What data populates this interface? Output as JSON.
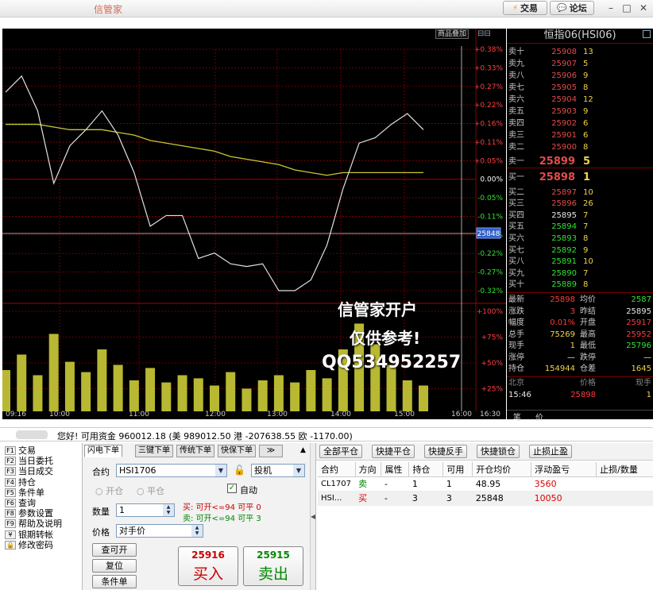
{
  "app": {
    "title": "信管家"
  },
  "titlebar": {
    "trade_label": "交易",
    "forum_label": "论坛",
    "min": "–",
    "max": "□",
    "close": "✕"
  },
  "chart": {
    "overlay_label": "商品叠加",
    "right_top_icons": "⊟⊟",
    "pct_labels": [
      "+0.38%",
      "+0.33%",
      "+0.27%",
      "+0.22%",
      "+0.16%",
      "+0.11%",
      "+0.05%",
      "0.00%",
      "-0.05%",
      "-0.11%",
      "-0.16%",
      "-0.22%",
      "-0.27%",
      "-0.32%"
    ],
    "vol_labels": [
      "+100%",
      "+75%",
      "+50%",
      "+25%"
    ],
    "time_labels": [
      "09:16",
      "10:00",
      "11:00",
      "12:00",
      "13:00",
      "14:00",
      "15:00",
      "16:00",
      "16:30"
    ],
    "cursor_value": "25848",
    "colors": {
      "price": "#e0e0e0",
      "avg": "#c8c832",
      "volume": "#b8b832",
      "grid": "#8b0000"
    }
  },
  "chart_data": {
    "type": "line",
    "x": [
      "09:16",
      "09:30",
      "09:45",
      "10:00",
      "10:15",
      "10:30",
      "10:45",
      "11:00",
      "11:15",
      "11:30",
      "11:45",
      "12:00",
      "12:15",
      "12:30",
      "12:45",
      "13:00",
      "13:15",
      "13:30",
      "13:45",
      "14:00",
      "14:15",
      "14:30",
      "14:45",
      "15:00",
      "15:15",
      "15:30",
      "15:45"
    ],
    "series": [
      {
        "values": [
          25912,
          25918,
          25905,
          25878,
          25892,
          25898,
          25905,
          25896,
          25882,
          25862,
          25866,
          25866,
          25850,
          25852,
          25848,
          25847,
          25848,
          25838,
          25838,
          25842,
          25855,
          25876,
          25893,
          25895,
          25900,
          25904,
          25898
        ]
      },
      {
        "values": [
          25900,
          25900,
          25900,
          25899,
          25898,
          25898,
          25898,
          25897,
          25896,
          25894,
          25893,
          25892,
          25891,
          25890,
          25888,
          25887,
          25886,
          25885,
          25883,
          25882,
          25881,
          25882,
          25882,
          25882,
          25882,
          25882,
          25882
        ]
      }
    ],
    "volume": [
      40,
      55,
      35,
      75,
      48,
      38,
      60,
      45,
      30,
      42,
      28,
      35,
      32,
      25,
      38,
      22,
      30,
      35,
      28,
      40,
      32,
      60,
      85,
      65,
      45,
      30,
      25
    ],
    "ylim": [
      25838,
      25928
    ],
    "vol_ylim": [
      0,
      100
    ]
  },
  "quote": {
    "title": "恒指06(HSI06)",
    "asks": [
      {
        "label": "卖十",
        "price": "25908",
        "vol": "13"
      },
      {
        "label": "卖九",
        "price": "25907",
        "vol": "5"
      },
      {
        "label": "卖八",
        "price": "25906",
        "vol": "9"
      },
      {
        "label": "卖七",
        "price": "25905",
        "vol": "8"
      },
      {
        "label": "卖六",
        "price": "25904",
        "vol": "12"
      },
      {
        "label": "卖五",
        "price": "25903",
        "vol": "9"
      },
      {
        "label": "卖四",
        "price": "25902",
        "vol": "6"
      },
      {
        "label": "卖三",
        "price": "25901",
        "vol": "6"
      },
      {
        "label": "卖二",
        "price": "25900",
        "vol": "8"
      },
      {
        "label": "卖一",
        "price": "25899",
        "vol": "5"
      }
    ],
    "bids": [
      {
        "label": "买一",
        "price": "25898",
        "vol": "1"
      },
      {
        "label": "买二",
        "price": "25897",
        "vol": "10"
      },
      {
        "label": "买三",
        "price": "25896",
        "vol": "26"
      },
      {
        "label": "买四",
        "price": "25895",
        "vol": "7"
      },
      {
        "label": "买五",
        "price": "25894",
        "vol": "7"
      },
      {
        "label": "买六",
        "price": "25893",
        "vol": "8"
      },
      {
        "label": "买七",
        "price": "25892",
        "vol": "9"
      },
      {
        "label": "买八",
        "price": "25891",
        "vol": "10"
      },
      {
        "label": "买九",
        "price": "25890",
        "vol": "7"
      },
      {
        "label": "买十",
        "price": "25889",
        "vol": "8"
      }
    ],
    "stats": [
      {
        "l1": "最新",
        "v1": "25898",
        "c1": "red",
        "l2": "均价",
        "v2": "2587",
        "c2": "grn"
      },
      {
        "l1": "涨跌",
        "v1": "3",
        "c1": "red",
        "l2": "昨结",
        "v2": "25895",
        "c2": "wht"
      },
      {
        "l1": "幅度",
        "v1": "0.01%",
        "c1": "red",
        "l2": "开盘",
        "v2": "25917",
        "c2": "red"
      },
      {
        "l1": "总手",
        "v1": "75269",
        "c1": "yel",
        "l2": "最高",
        "v2": "25952",
        "c2": "red"
      },
      {
        "l1": "现手",
        "v1": "1",
        "c1": "yel",
        "l2": "最低",
        "v2": "25796",
        "c2": "grn"
      },
      {
        "l1": "涨停",
        "v1": "—",
        "c1": "wht",
        "l2": "跌停",
        "v2": "—",
        "c2": "wht"
      },
      {
        "l1": "持仓",
        "v1": "154944",
        "c1": "yel",
        "l2": "仓差",
        "v2": "1645",
        "c2": "yel"
      }
    ],
    "tick_header": {
      "loc": "北京",
      "price": "价格",
      "vol": "现手"
    },
    "tick": {
      "time": "15:46",
      "price": "25898",
      "vol": "1"
    },
    "bottom_tabs": [
      "笔",
      "价"
    ]
  },
  "account": {
    "text": "您好! 可用资金 960012.18 (美 989012.50 港 -207638.55 欧 -1170.00)"
  },
  "menu": [
    {
      "key": "F1",
      "label": "交易"
    },
    {
      "key": "F2",
      "label": "当日委托"
    },
    {
      "key": "F3",
      "label": "当日成交"
    },
    {
      "key": "F4",
      "label": "持仓"
    },
    {
      "key": "F5",
      "label": "条件单"
    },
    {
      "key": "F6",
      "label": "查询"
    },
    {
      "key": "F8",
      "label": "参数设置"
    },
    {
      "key": "F9",
      "label": "帮助及说明"
    },
    {
      "key": "¥",
      "label": "银期转帐"
    },
    {
      "key": "🔒",
      "label": "修改密码"
    }
  ],
  "order": {
    "tabs": [
      "闪电下单",
      "三键下单",
      "传统下单",
      "快保下单",
      "≫"
    ],
    "contract_label": "合约",
    "contract_value": "HSI1706",
    "hedge_value": "投机",
    "open_label": "开仓",
    "close_label": "平仓",
    "auto_label": "自动",
    "qty_label": "数量",
    "qty_value": "1",
    "price_label": "价格",
    "price_value": "对手价",
    "sell_info": "买: 可开<=94    可平 0",
    "buy_info": "卖: 可开<=94    可平 3",
    "btn_query": "查可开",
    "btn_reset": "复位",
    "btn_cond": "条件单",
    "buy_price": "25916",
    "buy_label": "买入",
    "sell_price": "25915",
    "sell_label": "卖出"
  },
  "positions": {
    "toolbar": [
      "全部平仓",
      "快捷平仓",
      "快捷反手",
      "快捷锁仓",
      "止损止盈"
    ],
    "headers": [
      "合约",
      "方向",
      "属性",
      "持仓",
      "可用",
      "开仓均价",
      "浮动盈亏",
      "止损/数量"
    ],
    "rows": [
      {
        "contract": "CL1707",
        "dir": "卖",
        "attr": "-",
        "hold": "1",
        "avail": "1",
        "avg": "48.95",
        "pnl": "3560",
        "stop": ""
      },
      {
        "contract": "HSI...",
        "dir": "买",
        "attr": "-",
        "hold": "3",
        "avail": "3",
        "avg": "25848",
        "pnl": "10050",
        "stop": ""
      }
    ]
  },
  "watermark": {
    "line1": "信管家开户",
    "line2": "仅供参考!",
    "line3": "QQ534952257"
  }
}
